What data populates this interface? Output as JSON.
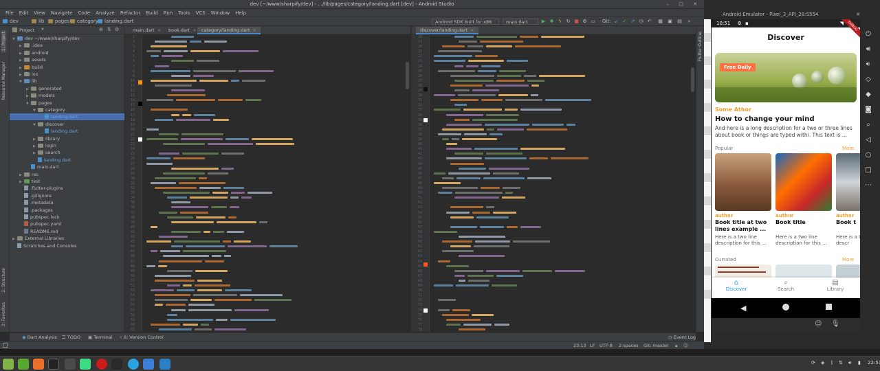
{
  "window": {
    "title": "dev [~/www/sharpify/dev] - .../lib/pages/category/landing.dart [dev] - Android Studio"
  },
  "menu": [
    "File",
    "Edit",
    "View",
    "Navigate",
    "Code",
    "Analyze",
    "Refactor",
    "Build",
    "Run",
    "Tools",
    "VCS",
    "Window",
    "Help"
  ],
  "breadcrumbs": [
    "dev",
    "lib",
    "pages",
    "category",
    "landing.dart"
  ],
  "toolbar": {
    "device": "Android SDK built for x86",
    "run_config": "main.dart",
    "git_label": "Git:"
  },
  "project_panel": {
    "selector": "Project",
    "tree": [
      {
        "label": "dev ~/www/sharpify/dev",
        "depth": 0,
        "kind": "folder",
        "color": "blue",
        "open": true
      },
      {
        "label": ".idea",
        "depth": 1,
        "kind": "folder",
        "color": "grey",
        "open": false
      },
      {
        "label": "android",
        "depth": 1,
        "kind": "folder",
        "color": "grey",
        "open": false
      },
      {
        "label": "assets",
        "depth": 1,
        "kind": "folder",
        "color": "grey",
        "open": false
      },
      {
        "label": "build",
        "depth": 1,
        "kind": "folder",
        "color": "orange",
        "open": false
      },
      {
        "label": "ios",
        "depth": 1,
        "kind": "folder",
        "color": "grey",
        "open": false
      },
      {
        "label": "lib",
        "depth": 1,
        "kind": "folder",
        "color": "blue",
        "open": true
      },
      {
        "label": "generated",
        "depth": 2,
        "kind": "folder",
        "color": "grey",
        "open": false
      },
      {
        "label": "models",
        "depth": 2,
        "kind": "folder",
        "color": "grey",
        "open": false
      },
      {
        "label": "pages",
        "depth": 2,
        "kind": "folder",
        "color": "grey",
        "open": true
      },
      {
        "label": "category",
        "depth": 3,
        "kind": "folder",
        "color": "grey",
        "open": true
      },
      {
        "label": "landing.dart",
        "depth": 4,
        "kind": "dart",
        "selected": true
      },
      {
        "label": "discover",
        "depth": 3,
        "kind": "folder",
        "color": "grey",
        "open": true
      },
      {
        "label": "landing.dart",
        "depth": 4,
        "kind": "dart"
      },
      {
        "label": "library",
        "depth": 3,
        "kind": "folder",
        "color": "grey",
        "open": false
      },
      {
        "label": "login",
        "depth": 3,
        "kind": "folder",
        "color": "grey",
        "open": false
      },
      {
        "label": "search",
        "depth": 3,
        "kind": "folder",
        "color": "grey",
        "open": false
      },
      {
        "label": "landing.dart",
        "depth": 3,
        "kind": "dart"
      },
      {
        "label": "main.dart",
        "depth": 2,
        "kind": "dart"
      },
      {
        "label": "res",
        "depth": 1,
        "kind": "folder",
        "color": "grey",
        "open": false
      },
      {
        "label": "test",
        "depth": 1,
        "kind": "folder",
        "color": "green",
        "open": false
      },
      {
        "label": ".flutter-plugins",
        "depth": 1,
        "kind": "file"
      },
      {
        "label": ".gitignore",
        "depth": 1,
        "kind": "file"
      },
      {
        "label": ".metadata",
        "depth": 1,
        "kind": "file"
      },
      {
        "label": ".packages",
        "depth": 1,
        "kind": "file"
      },
      {
        "label": "pubspec.lock",
        "depth": 1,
        "kind": "file"
      },
      {
        "label": "pubspec.yaml",
        "depth": 1,
        "kind": "yaml"
      },
      {
        "label": "README.md",
        "depth": 1,
        "kind": "md"
      },
      {
        "label": "External Libraries",
        "depth": 0,
        "kind": "lib",
        "open": false
      },
      {
        "label": "Scratches and Consoles",
        "depth": 0,
        "kind": "scratch"
      }
    ]
  },
  "left_strip_tabs": [
    "1: Project",
    "Resource Manager",
    "2: Structure",
    "2: Favorites"
  ],
  "right_strip_tabs": [
    "Flutter Outline"
  ],
  "editor_left": {
    "tabs": [
      "main.dart",
      "book.dart",
      "category/landing.dart"
    ],
    "active_tab": 2,
    "line_start": 1,
    "line_count": 61
  },
  "editor_right": {
    "tabs": [
      "discover/landing.dart"
    ],
    "active_tab": 0,
    "line_start": 18,
    "line_count": 61
  },
  "bottom_tabs": [
    "Dart Analysis",
    "TODO",
    "Terminal",
    "6: Version Control"
  ],
  "event_log": "Event Log",
  "status": {
    "position": "23:13",
    "line_sep": "LF",
    "encoding": "UTF-8",
    "indent": "2 spaces",
    "git_branch": "Git: master"
  },
  "emulator": {
    "window_title": "Android Emulator - Pixel_3_API_28:5554",
    "status_time": "10:51",
    "debug_badge": "DEBUG",
    "app": {
      "title": "Discover",
      "featured_badge": "Free Daily",
      "author": "Some Athor",
      "headline": "How to change your mind",
      "description": "And here is a long description for a two or three lines about book or things are typed withi. This text is ...",
      "popular_label": "Popular",
      "more_label": "More",
      "books": [
        {
          "author": "author",
          "title": "Book title at two lines example ...",
          "desc": "Here is a two line description for this ..."
        },
        {
          "author": "author",
          "title": "Book title",
          "desc": "Here is a two line description for this ..."
        },
        {
          "author": "author",
          "title": "Book t",
          "desc": "Here is a two line descr"
        }
      ],
      "curated_label": "Currated",
      "curated_more": "More",
      "nav": [
        "Discover",
        "Search",
        "Library"
      ],
      "nav_active": 0
    }
  },
  "clock": "22:51",
  "colors": {
    "accent": "#ff7043",
    "nav_active": "#2196f3",
    "ide_bg": "#2b2b2b",
    "panel": "#3c3f41"
  }
}
